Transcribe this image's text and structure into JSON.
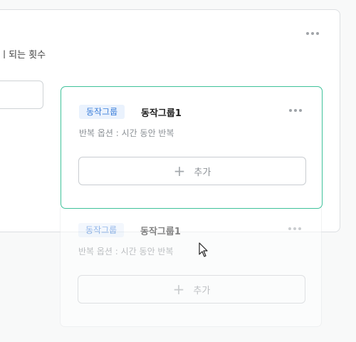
{
  "outer": {
    "label_partial": "되는 횟수"
  },
  "groups": [
    {
      "tag": "동작그룹",
      "title": "동작그룹1",
      "subtitle": "반복 옵션 : 시간 동안 반복",
      "add_label": "추가"
    },
    {
      "tag": "동작그룹",
      "title": "동작그룹1",
      "subtitle": "반복 옵션 : 시간 동안 반복",
      "add_label": "추가"
    }
  ],
  "icons": {
    "more": "more-horizontal-icon",
    "plus": "plus-icon",
    "cursor": "mouse-pointer-icon"
  },
  "colors": {
    "accent_border": "#3fc29a",
    "tag_bg": "#eaf2fd",
    "tag_text": "#3b7ed9"
  }
}
